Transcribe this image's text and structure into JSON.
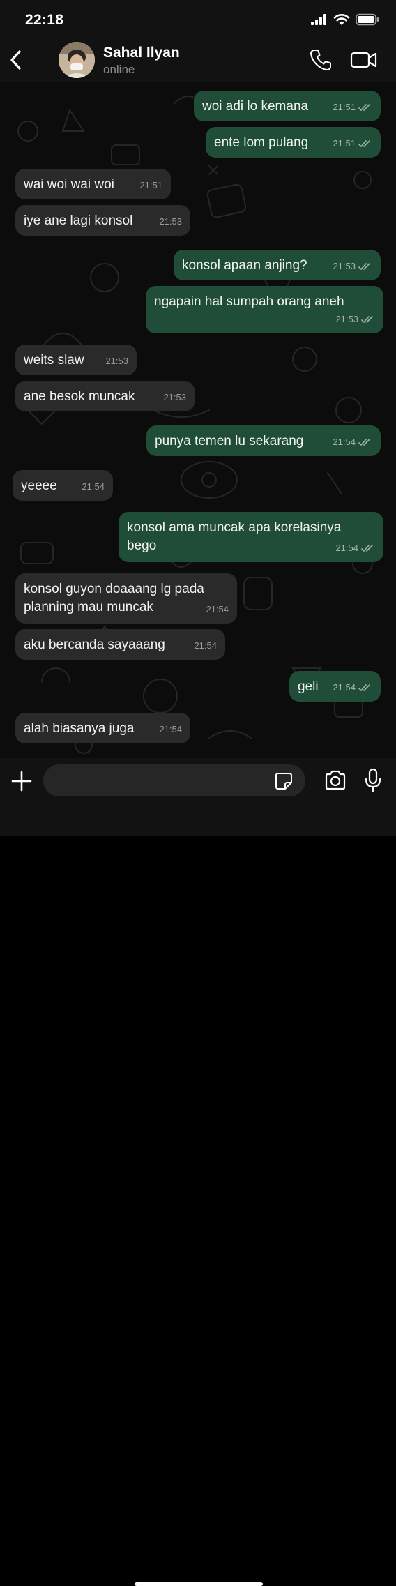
{
  "status_bar": {
    "time": "22:18",
    "icons": [
      "cellular-signal-icon",
      "wifi-icon",
      "battery-icon"
    ]
  },
  "header": {
    "back_icon": "chevron-left-icon",
    "contact_name": "Sahal Ilyan",
    "contact_status": "online",
    "call_icon": "phone-icon",
    "video_icon": "video-camera-icon"
  },
  "messages": [
    {
      "dir": "out",
      "text": "woi adi lo kemana",
      "time": "21:51",
      "read": true
    },
    {
      "dir": "out",
      "text": "ente lom pulang",
      "time": "21:51",
      "read": true
    },
    {
      "dir": "in",
      "text": "wai woi wai woi",
      "time": "21:51"
    },
    {
      "dir": "in",
      "text": "iye ane lagi konsol",
      "time": "21:53"
    },
    {
      "dir": "out",
      "text": "konsol apaan anjing?",
      "time": "21:53",
      "read": true
    },
    {
      "dir": "out",
      "text": "ngapain hal sumpah orang aneh",
      "time": "21:53",
      "read": true
    },
    {
      "dir": "in",
      "text": "weits slaw",
      "time": "21:53"
    },
    {
      "dir": "in",
      "text": "ane besok muncak",
      "time": "21:53"
    },
    {
      "dir": "out",
      "text": "punya temen lu sekarang",
      "time": "21:54",
      "read": true
    },
    {
      "dir": "in",
      "text": "yeeee",
      "time": "21:54"
    },
    {
      "dir": "out",
      "text": "konsol ama muncak apa korelasinya\nbego",
      "time": "21:54",
      "read": true
    },
    {
      "dir": "in",
      "text": "konsol guyon doaaang lg pada\nplanning mau muncak",
      "time": "21:54"
    },
    {
      "dir": "in",
      "text": "aku bercanda sayaaang",
      "time": "21:54"
    },
    {
      "dir": "out",
      "text": "geli",
      "time": "21:54",
      "read": true
    },
    {
      "dir": "in",
      "text": "alah biasanya juga",
      "time": "21:54"
    }
  ],
  "input_bar": {
    "placeholder": "",
    "plus_icon": "plus-icon",
    "sticker_icon": "sticker-icon",
    "camera_icon": "camera-icon",
    "mic_icon": "microphone-icon"
  },
  "colors": {
    "incoming_bubble": "#2a2a2a",
    "outgoing_bubble": "#1f4d37",
    "background": "#0c0c0c",
    "bars": "#121212",
    "read_tick": "#a8b3ad"
  }
}
